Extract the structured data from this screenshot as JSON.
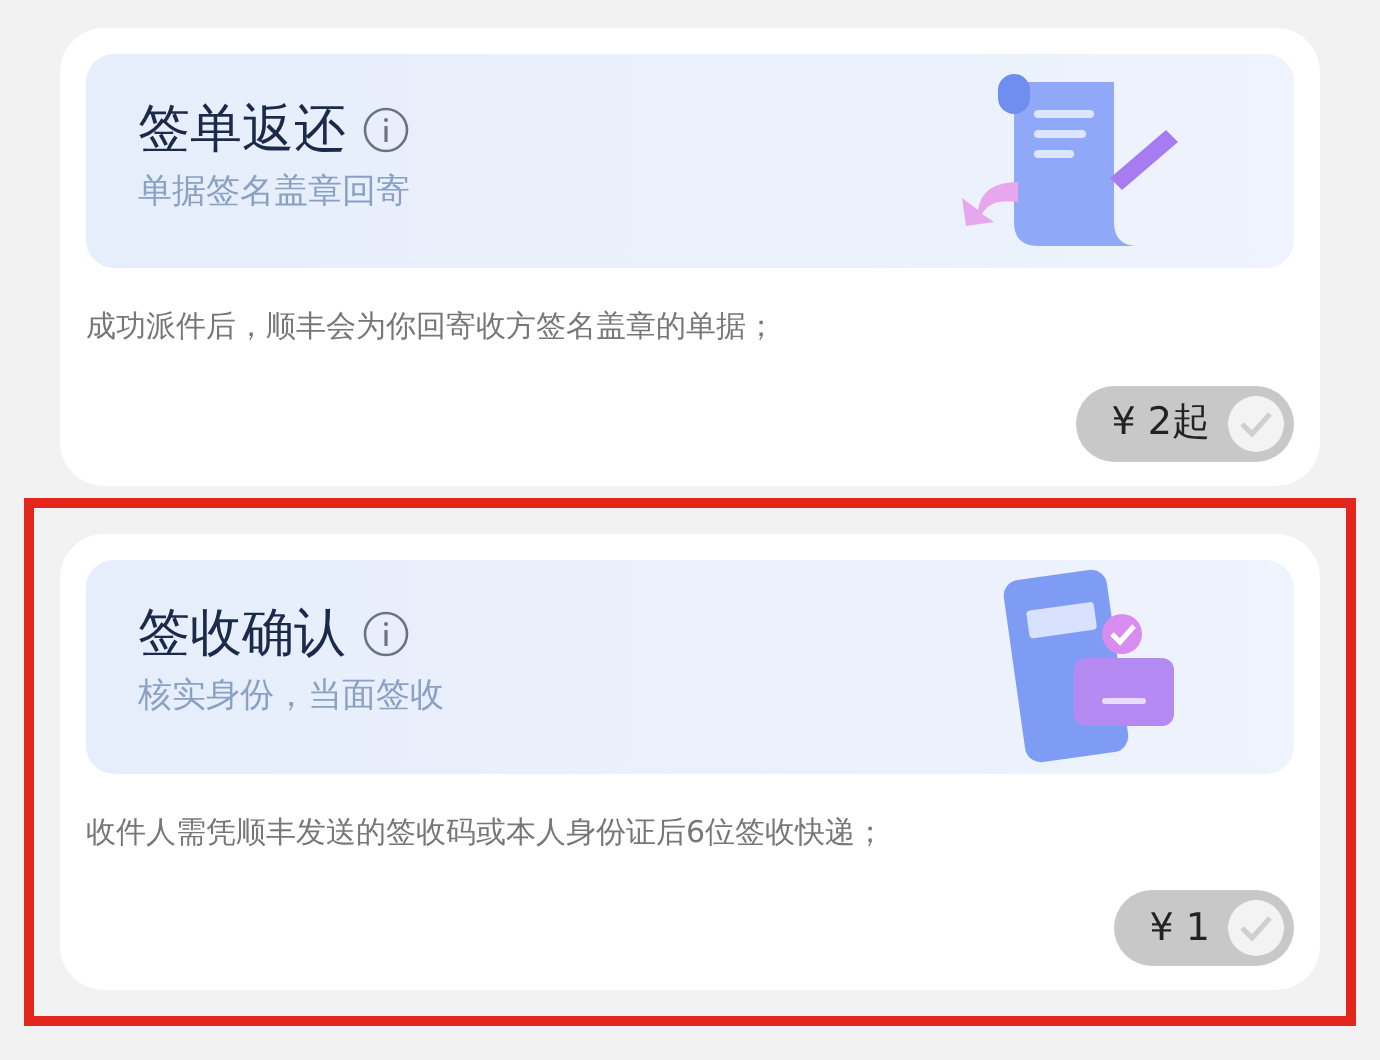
{
  "services": [
    {
      "kind": "return",
      "title": "签单返还",
      "subtitle": "单据签名盖章回寄",
      "description": "成功派件后，顺丰会为你回寄收方签名盖章的单据；",
      "price": "¥ 2起",
      "selected": false,
      "highlighted": false
    },
    {
      "kind": "confirm",
      "title": "签收确认",
      "subtitle": "核实身份，当面签收",
      "description": "收件人需凭顺丰发送的签收码或本人身份证后6位签收快递；",
      "price": "¥ 1",
      "selected": false,
      "highlighted": true
    }
  ]
}
